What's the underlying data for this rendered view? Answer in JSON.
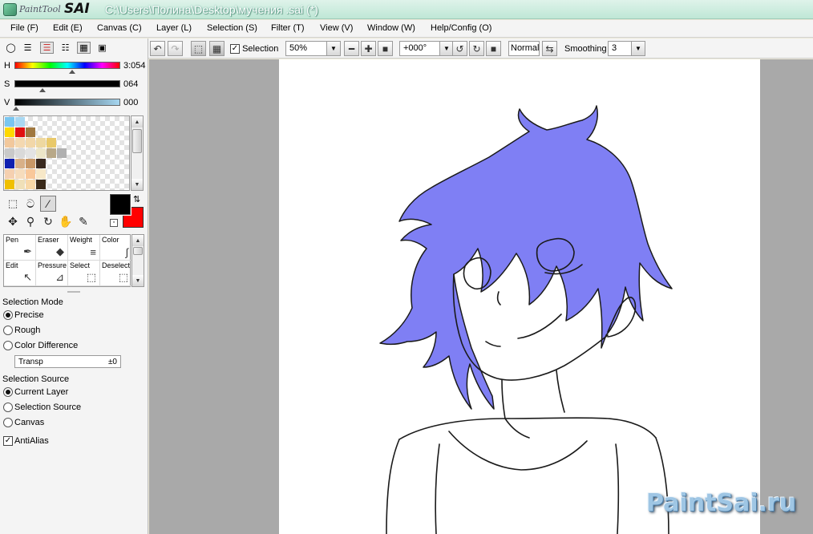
{
  "window": {
    "logo_text": "PaintTool",
    "logo_brand": "SAI",
    "title": "C:\\Users\\Полина\\Desktop\\мучения .sai (*)"
  },
  "menu": [
    {
      "label": "File (F)"
    },
    {
      "label": "Edit (E)"
    },
    {
      "label": "Canvas (C)"
    },
    {
      "label": "Layer (L)"
    },
    {
      "label": "Selection (S)"
    },
    {
      "label": "Filter (T)"
    },
    {
      "label": "View (V)"
    },
    {
      "label": "Window (W)"
    },
    {
      "label": "Help/Config (O)"
    }
  ],
  "toolbar": {
    "selection_label": "Selection",
    "selection_checked": true,
    "zoom": "50%",
    "rotation": "+000°",
    "blend_mode": "Normal",
    "smoothing_label": "Smoothing",
    "smoothing_value": "3"
  },
  "color": {
    "h_label": "H",
    "h_value": "3:054",
    "s_label": "S",
    "s_value": "064",
    "v_label": "V",
    "v_value": "000",
    "primary": "#000000",
    "secondary": "#ff0000"
  },
  "swatches": [
    [
      "#79c6f0",
      "#a9d8f2",
      null,
      null,
      null,
      null
    ],
    [
      "#ffd800",
      "#e01010",
      "#a07840",
      null,
      null,
      null
    ],
    [
      "#f2c89c",
      "#f4d8b0",
      "#f2d7a8",
      "#eed8a0",
      "#e9c96a",
      null
    ],
    [
      "#c9c9c9",
      "#d9d9d9",
      "#e3e3e3",
      "#ece6c8",
      "#b8a888",
      "#b0b0b0"
    ],
    [
      "#1020b0",
      "#d8b088",
      "#c89868",
      "#3a2a20",
      null,
      null
    ],
    [
      "#f5d0b0",
      "#f6dcbc",
      "#f9c89a",
      "#f7e8c8",
      null,
      null
    ],
    [
      "#f0c000",
      "#f0e0b8",
      "#f8d8a8",
      "#3a2a1a",
      null,
      null
    ]
  ],
  "brushes": [
    {
      "label": "Pen",
      "icon": "pen-icon"
    },
    {
      "label": "Eraser",
      "icon": "eraser-icon"
    },
    {
      "label": "Weight",
      "icon": "weight-icon"
    },
    {
      "label": "Color",
      "icon": "color-curve-icon"
    },
    {
      "label": "Edit",
      "icon": "edit-arrow-icon"
    },
    {
      "label": "Pressure",
      "icon": "pressure-icon"
    },
    {
      "label": "Select",
      "icon": "select-brush-icon"
    },
    {
      "label": "Deselect",
      "icon": "deselect-brush-icon"
    }
  ],
  "selection_mode": {
    "title": "Selection Mode",
    "options": [
      {
        "label": "Precise",
        "selected": true
      },
      {
        "label": "Rough",
        "selected": false
      },
      {
        "label": "Color Difference",
        "selected": false
      }
    ],
    "transp_label": "Transp",
    "transp_value": "±0"
  },
  "selection_source": {
    "title": "Selection Source",
    "options": [
      {
        "label": "Current Layer",
        "selected": true
      },
      {
        "label": "Selection Source",
        "selected": false
      },
      {
        "label": "Canvas",
        "selected": false
      }
    ],
    "antialias_label": "AntiAlias",
    "antialias_checked": true
  },
  "canvas": {
    "hair_color": "#7f7ff4",
    "line_color": "#1a1a1a"
  },
  "watermark": "PaintSai.ru"
}
